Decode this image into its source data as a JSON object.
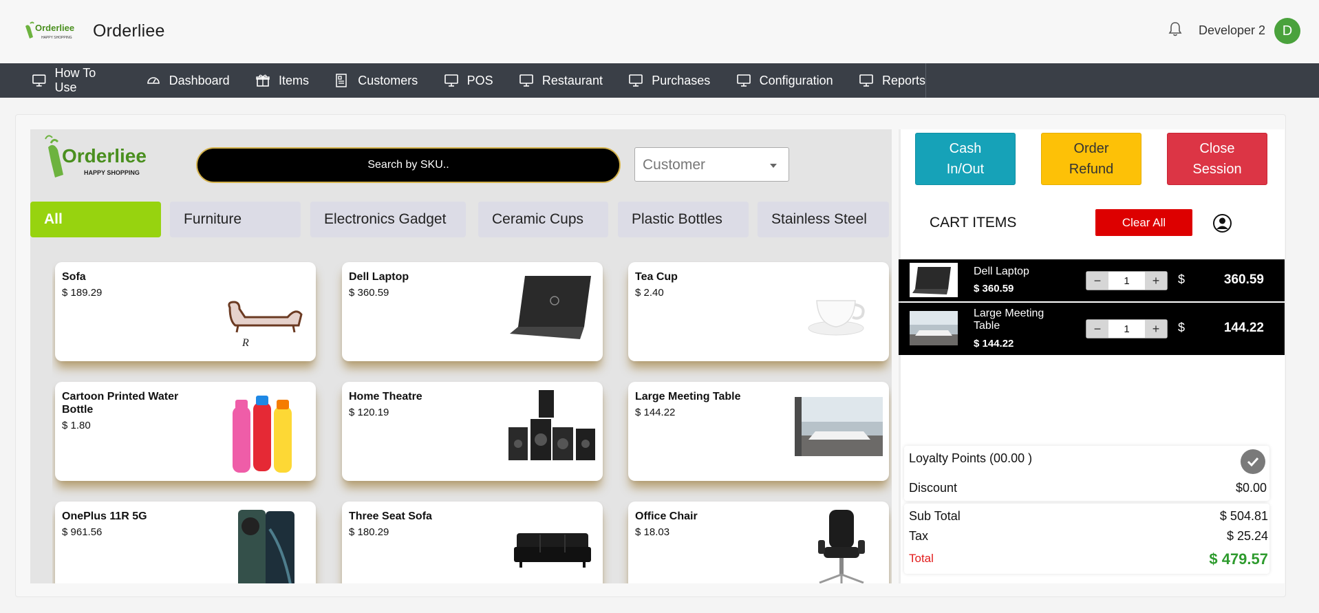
{
  "header": {
    "brand_name": "Orderliee",
    "logo_text": "Orderliee",
    "logo_tagline": "HAPPY SHOPPING",
    "user_name": "Developer 2",
    "avatar_initial": "D"
  },
  "nav": [
    {
      "label": "How To Use",
      "icon": "monitor-icon"
    },
    {
      "label": "Dashboard",
      "icon": "dashboard-icon"
    },
    {
      "label": "Items",
      "icon": "gift-icon"
    },
    {
      "label": "Customers",
      "icon": "customers-icon"
    },
    {
      "label": "POS",
      "icon": "monitor-icon"
    },
    {
      "label": "Restaurant",
      "icon": "monitor-icon"
    },
    {
      "label": "Purchases",
      "icon": "monitor-icon"
    },
    {
      "label": "Configuration",
      "icon": "monitor-icon"
    },
    {
      "label": "Reports",
      "icon": "monitor-icon"
    }
  ],
  "search": {
    "placeholder": "Search by SKU.."
  },
  "customer_select": {
    "selected": "Customer"
  },
  "categories": [
    "All",
    "Furniture",
    "Electronics Gadget",
    "Ceramic Cups",
    "Plastic Bottles",
    "Stainless Steel"
  ],
  "products": [
    {
      "name": "Sofa",
      "price": "$ 189.29"
    },
    {
      "name": "Dell Laptop",
      "price": "$ 360.59"
    },
    {
      "name": "Tea Cup",
      "price": "$ 2.40"
    },
    {
      "name": "Cartoon Printed Water Bottle",
      "price": "$ 1.80"
    },
    {
      "name": "Home Theatre",
      "price": "$ 120.19"
    },
    {
      "name": "Large Meeting Table",
      "price": "$ 144.22"
    },
    {
      "name": "OnePlus 11R 5G",
      "price": "$ 961.56"
    },
    {
      "name": "Three Seat Sofa",
      "price": "$ 180.29"
    },
    {
      "name": "Office Chair",
      "price": "$ 18.03"
    }
  ],
  "actions": {
    "cash": "Cash In/Out",
    "refund": "Order Refund",
    "close": "Close Session"
  },
  "cart": {
    "title": "CART ITEMS",
    "clear_label": "Clear All",
    "items": [
      {
        "name": "Dell Laptop",
        "price": "$ 360.59",
        "qty": "1",
        "currency": "$",
        "total": "360.59"
      },
      {
        "name": "Large Meeting Table",
        "price": "$ 144.22",
        "qty": "1",
        "currency": "$",
        "total": "144.22"
      }
    ]
  },
  "summary": {
    "loyalty_label": "Loyalty Points (00.00 )",
    "discount_label": "Discount",
    "discount_value": "$0.00",
    "subtotal_label": "Sub Total",
    "subtotal_value": "$  504.81",
    "tax_label": "Tax",
    "tax_value": "$  25.24",
    "total_label": "Total",
    "total_value": "$  479.57"
  },
  "colors": {
    "nav_bg": "#3a3f47",
    "active_category": "#97d30f",
    "cash_button": "#16a2b8",
    "refund_button": "#fdc107",
    "close_button": "#dc3545",
    "clear_button": "#dd0000",
    "total_green": "#2e9b2e"
  }
}
